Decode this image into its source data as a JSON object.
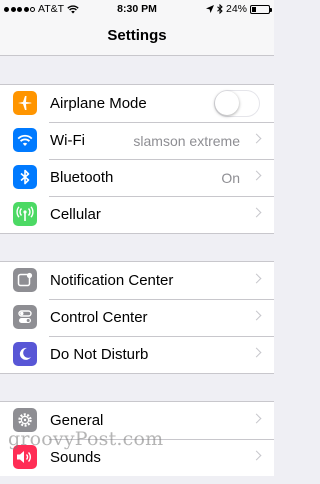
{
  "status_bar": {
    "carrier": "AT&T",
    "time": "8:30 PM",
    "battery": "24%",
    "battery_level": 0.24,
    "signal_bars_filled": 4,
    "signal_bars_total": 5
  },
  "nav": {
    "title": "Settings"
  },
  "group1": [
    {
      "label": "Airplane Mode",
      "icon": "airplane-icon",
      "color": "#ff9500",
      "toggle_on": false
    },
    {
      "label": "Wi-Fi",
      "icon": "wifi-icon",
      "color": "#007aff",
      "detail": "slamson extreme"
    },
    {
      "label": "Bluetooth",
      "icon": "bluetooth-icon",
      "color": "#007aff",
      "detail": "On"
    },
    {
      "label": "Cellular",
      "icon": "cellular-icon",
      "color": "#4cd964"
    }
  ],
  "group2": [
    {
      "label": "Notification Center",
      "icon": "notification-center-icon",
      "color": "#8e8e93"
    },
    {
      "label": "Control Center",
      "icon": "control-center-icon",
      "color": "#8e8e93"
    },
    {
      "label": "Do Not Disturb",
      "icon": "moon-icon",
      "color": "#5856d6"
    }
  ],
  "group3": [
    {
      "label": "General",
      "icon": "gear-icon",
      "color": "#8e8e93"
    },
    {
      "label": "Sounds",
      "icon": "speaker-icon",
      "color": "#ff2d55"
    }
  ],
  "watermark": "groovyPost.com"
}
